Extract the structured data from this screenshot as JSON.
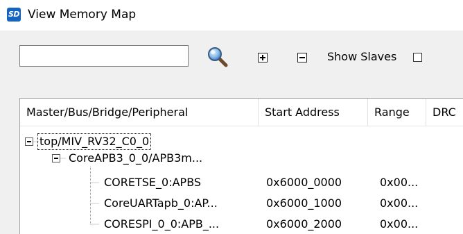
{
  "window": {
    "title": "View Memory Map",
    "app_icon_text": "SD"
  },
  "toolbar": {
    "search_value": "",
    "search_icon": "magnifier-icon",
    "expand_icon": "plus-box-icon",
    "collapse_icon": "minus-box-icon",
    "show_slaves_label": "Show Slaves",
    "show_slaves_checked": false
  },
  "columns": [
    "Master/Bus/Bridge/Peripheral",
    "Start Address",
    "Range",
    "DRC"
  ],
  "tree": {
    "root": {
      "label": "top/MIV_RV32_C0_0",
      "expanded": true
    },
    "bus": {
      "label": "CoreAPB3_0_0/APB3m...",
      "expanded": true
    },
    "peripherals": [
      {
        "label": "CORETSE_0:APBS",
        "start": "0x6000_0000",
        "range": "0x00..."
      },
      {
        "label": "CoreUARTapb_0:AP...",
        "start": "0x6000_1000",
        "range": "0x00..."
      },
      {
        "label": "CORESPI_0_0:APB_...",
        "start": "0x6000_2000",
        "range": "0x00..."
      }
    ]
  }
}
